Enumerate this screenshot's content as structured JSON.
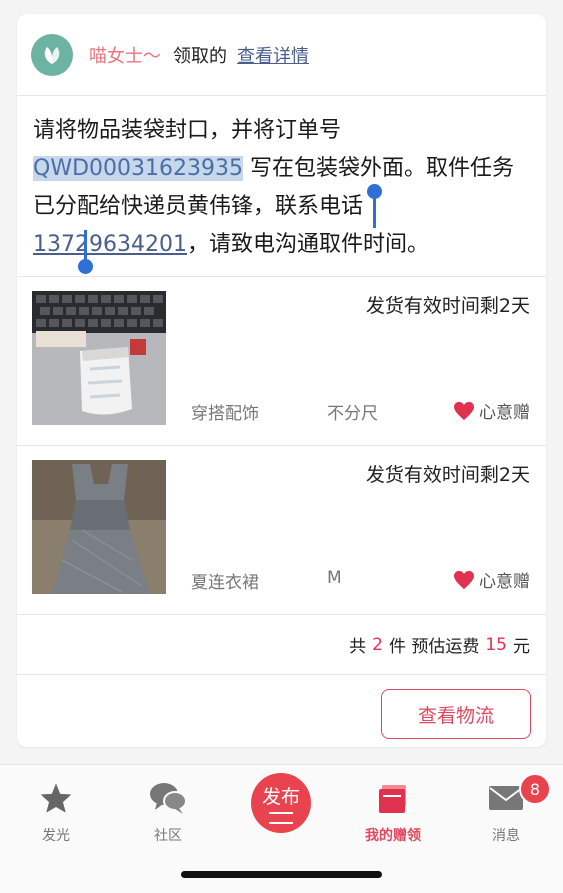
{
  "header": {
    "username": "喵女士～",
    "action": "领取的",
    "detail_link": "查看详情"
  },
  "message": {
    "before": "请将物品装袋封口，并将订单号",
    "order_part1": "QWD0003162",
    "order_part2": "3935",
    "middle": "写在包装袋外面。取件任务已分配给快递员黄伟锋，联系电话",
    "phone": "13729634201",
    "after": "，请致电沟通取件时间。"
  },
  "items": [
    {
      "expire": "发货有效时间剩2天",
      "category": "穿搭配饰",
      "size": "不分尺",
      "gift": "心意赠"
    },
    {
      "expire": "发货有效时间剩2天",
      "category": "夏连衣裙",
      "size": "M",
      "gift": "心意赠"
    }
  ],
  "summary": {
    "prefix": "共",
    "count": "2",
    "mid": "件 预估运费",
    "fee": "15",
    "suffix": "元"
  },
  "logistics_button": "查看物流",
  "tabbar": {
    "items": [
      {
        "label": "发光",
        "icon": "star-icon"
      },
      {
        "label": "社区",
        "icon": "chat-bubbles-icon"
      },
      {
        "label": "发布",
        "icon": "publish-icon"
      },
      {
        "label": "我的赠领",
        "icon": "gift-box-icon"
      },
      {
        "label": "消息",
        "icon": "envelope-icon"
      }
    ],
    "message_badge": "8"
  },
  "colors": {
    "accent": "#e04a60",
    "link": "#4a5e8c",
    "selection": "#c7d7ec",
    "selection_handle": "#2f6fd6",
    "avatar": "#6cb3a4"
  }
}
